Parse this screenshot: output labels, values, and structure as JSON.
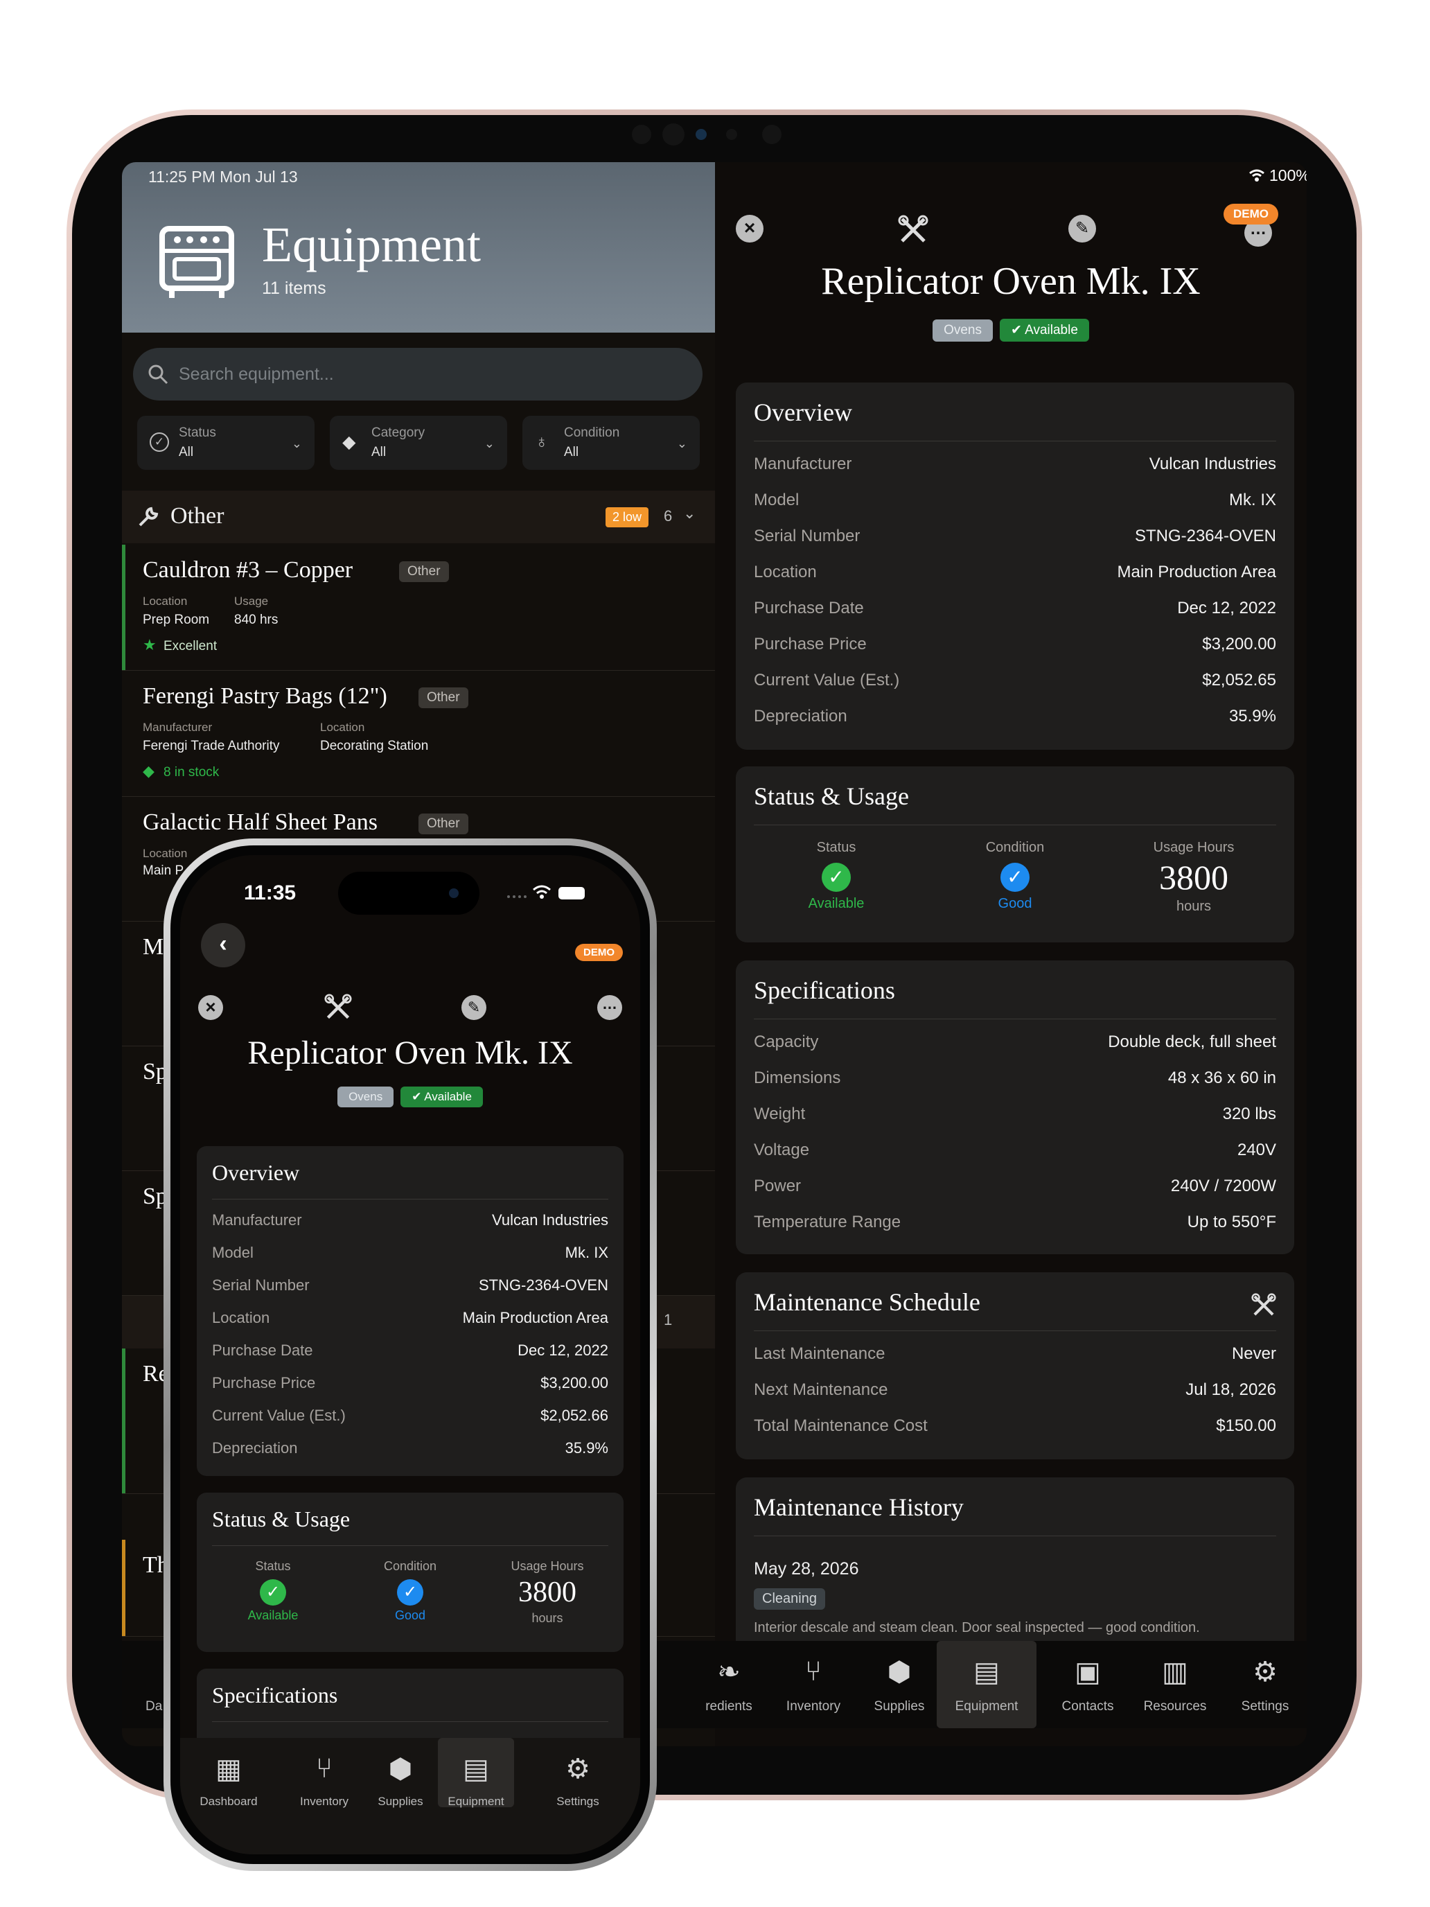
{
  "tablet": {
    "status_time": "11:25 PM  Mon Jul 13",
    "battery": "100%",
    "header": {
      "title": "Equipment",
      "subtitle": "11 items"
    },
    "search_placeholder": "Search equipment...",
    "filters": [
      {
        "label": "Status",
        "value": "All"
      },
      {
        "label": "Category",
        "value": "All"
      },
      {
        "label": "Condition",
        "value": "All"
      }
    ],
    "section": {
      "title": "Other",
      "low_badge": "2 low",
      "count": "6"
    },
    "items": [
      {
        "name": "Cauldron #3 – Copper",
        "tag": "Other",
        "m1_label": "Location",
        "m1_value": "Prep Room",
        "m2_label": "Usage",
        "m2_value": "840 hrs",
        "status": "Excellent"
      },
      {
        "name": "Ferengi Pastry Bags (12\")",
        "tag": "Other",
        "m1_label": "Manufacturer",
        "m1_value": "Ferengi Trade Authority",
        "m2_label": "Location",
        "m2_value": "Decorating Station",
        "status": "8 in stock"
      },
      {
        "name": "Galactic Half Sheet Pans",
        "tag": "Other",
        "m1_label": "Location",
        "m1_value": "Main P"
      }
    ],
    "partial_rows": [
      "M",
      "Sp",
      "Sp",
      "Re",
      "Th"
    ],
    "partial_count_1": "1",
    "detail": {
      "title": "Replicator Oven Mk. IX",
      "demo": "DEMO",
      "category_chip": "Ovens",
      "status_chip": "Available",
      "overview": {
        "title": "Overview",
        "rows": [
          {
            "k": "Manufacturer",
            "v": "Vulcan Industries"
          },
          {
            "k": "Model",
            "v": "Mk. IX"
          },
          {
            "k": "Serial Number",
            "v": "STNG-2364-OVEN"
          },
          {
            "k": "Location",
            "v": "Main Production Area"
          },
          {
            "k": "Purchase Date",
            "v": "Dec 12, 2022"
          },
          {
            "k": "Purchase Price",
            "v": "$3,200.00"
          },
          {
            "k": "Current Value (Est.)",
            "v": "$2,052.65"
          },
          {
            "k": "Depreciation",
            "v": "35.9%"
          }
        ]
      },
      "status_usage": {
        "title": "Status & Usage",
        "status_label": "Status",
        "status_value": "Available",
        "condition_label": "Condition",
        "condition_value": "Good",
        "hours_label": "Usage Hours",
        "hours_value": "3800",
        "hours_unit": "hours"
      },
      "specs": {
        "title": "Specifications",
        "rows": [
          {
            "k": "Capacity",
            "v": "Double deck, full sheet"
          },
          {
            "k": "Dimensions",
            "v": "48 x 36 x 60 in"
          },
          {
            "k": "Weight",
            "v": "320 lbs"
          },
          {
            "k": "Voltage",
            "v": "240V"
          },
          {
            "k": "Power",
            "v": "240V / 7200W"
          },
          {
            "k": "Temperature Range",
            "v": "Up to 550°F"
          }
        ]
      },
      "maintenance": {
        "title": "Maintenance Schedule",
        "rows": [
          {
            "k": "Last Maintenance",
            "v": "Never"
          },
          {
            "k": "Next Maintenance",
            "v": "Jul 18, 2026"
          },
          {
            "k": "Total Maintenance Cost",
            "v": "$150.00"
          }
        ]
      },
      "history": {
        "title": "Maintenance History",
        "date": "May 28, 2026",
        "type": "Cleaning",
        "note": "Interior descale and steam clean. Door seal inspected — good condition."
      }
    },
    "tabs": [
      {
        "label": "redients",
        "icon": "leaf-icon"
      },
      {
        "label": "Inventory",
        "icon": "utensils-icon"
      },
      {
        "label": "Supplies",
        "icon": "box-icon"
      },
      {
        "label": "Equipment",
        "icon": "oven-icon"
      },
      {
        "label": "Contacts",
        "icon": "contact-card-icon"
      },
      {
        "label": "Resources",
        "icon": "document-icon"
      },
      {
        "label": "Settings",
        "icon": "gear-icon"
      }
    ],
    "left_tab_partial": "Da"
  },
  "phone": {
    "time": "11:35",
    "demo": "DEMO",
    "title": "Replicator Oven Mk. IX",
    "category_chip": "Ovens",
    "status_chip": "Available",
    "overview": {
      "title": "Overview",
      "rows": [
        {
          "k": "Manufacturer",
          "v": "Vulcan Industries"
        },
        {
          "k": "Model",
          "v": "Mk. IX"
        },
        {
          "k": "Serial Number",
          "v": "STNG-2364-OVEN"
        },
        {
          "k": "Location",
          "v": "Main Production Area"
        },
        {
          "k": "Purchase Date",
          "v": "Dec 12, 2022"
        },
        {
          "k": "Purchase Price",
          "v": "$3,200.00"
        },
        {
          "k": "Current Value (Est.)",
          "v": "$2,052.66"
        },
        {
          "k": "Depreciation",
          "v": "35.9%"
        }
      ]
    },
    "status_usage": {
      "title": "Status & Usage",
      "status_label": "Status",
      "status_value": "Available",
      "condition_label": "Condition",
      "condition_value": "Good",
      "hours_label": "Usage Hours",
      "hours_value": "3800",
      "hours_unit": "hours"
    },
    "specs_title": "Specifications",
    "tabs": [
      {
        "label": "Dashboard",
        "icon": "dashboard-icon"
      },
      {
        "label": "Inventory",
        "icon": "utensils-icon"
      },
      {
        "label": "Supplies",
        "icon": "box-icon"
      },
      {
        "label": "Equipment",
        "icon": "oven-icon"
      },
      {
        "label": "Settings",
        "icon": "gear-icon"
      }
    ]
  },
  "colors": {
    "accent_green": "#2fb84a",
    "accent_blue": "#1d8bf0",
    "demo_orange": "#f2862b",
    "header_slate": "#6b7680"
  }
}
